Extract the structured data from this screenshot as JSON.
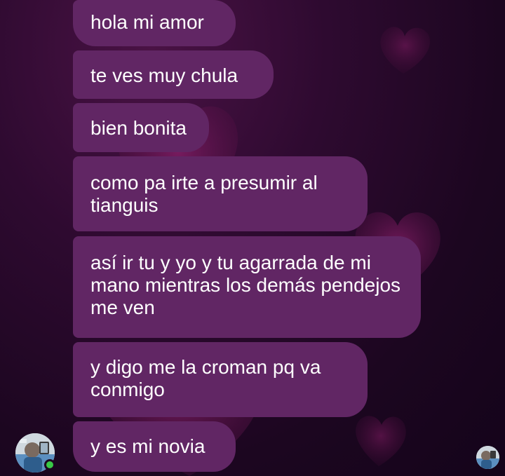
{
  "chat": {
    "messages": [
      {
        "text": "hola mi amor"
      },
      {
        "text": "te ves muy chula"
      },
      {
        "text": "bien bonita"
      },
      {
        "text": "como pa irte a presumir al tianguis"
      },
      {
        "text": "así ir tu y yo y tu agarrada de mi mano mientras los demás pendejos me ven"
      },
      {
        "text": "y digo me la croman pq va conmigo"
      },
      {
        "text": "y es mi novia"
      }
    ],
    "sender_online": true
  },
  "theme": {
    "bubble_color": "#612664",
    "background_color": "#1c0620",
    "text_color": "#ffffff",
    "online_color": "#39c946"
  },
  "icons": {
    "sender_avatar": "avatar-photo",
    "seen_avatar": "avatar-photo",
    "background_decoration": "heart-icon"
  }
}
